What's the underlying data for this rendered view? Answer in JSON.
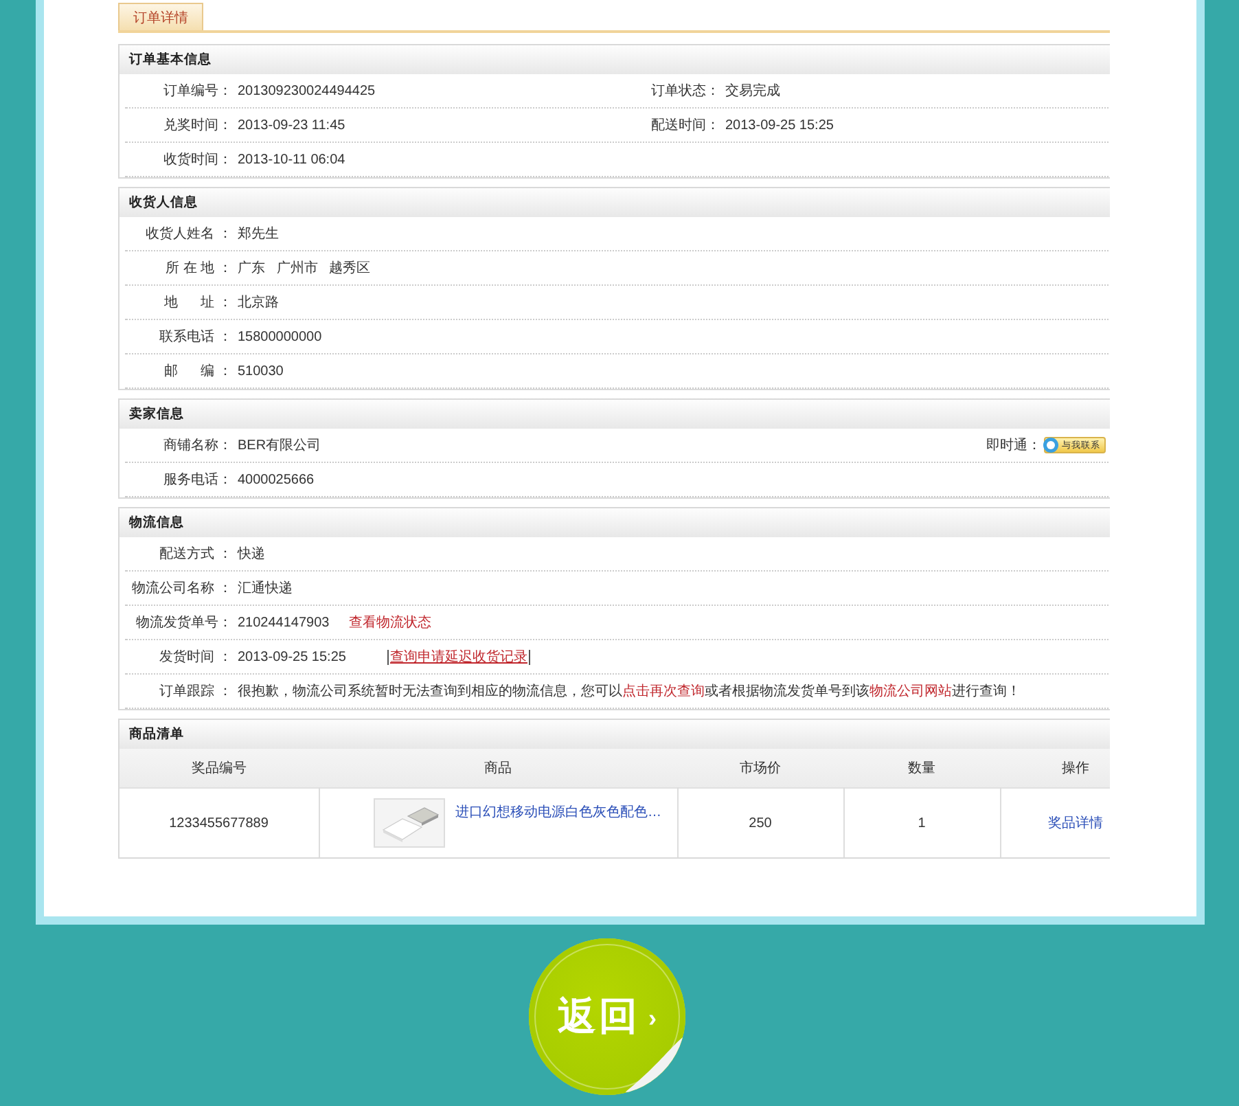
{
  "tab": {
    "label": "订单详情",
    "selected": true
  },
  "sections": [
    {
      "title": "订单基本信息",
      "kind": "fields",
      "rows": [
        {
          "fields": [
            {
              "label": "订单编号：",
              "parts": [
                {
                  "kind": "text",
                  "text": "201309230024494425"
                }
              ]
            },
            {
              "label": "订单状态：",
              "parts": [
                {
                  "kind": "text",
                  "text": "交易完成"
                }
              ]
            }
          ]
        },
        {
          "fields": [
            {
              "label": "兑奖时间：",
              "parts": [
                {
                  "kind": "text",
                  "text": "2013-09-23 11:45"
                }
              ]
            },
            {
              "label": "配送时间：",
              "parts": [
                {
                  "kind": "text",
                  "text": "2013-09-25 15:25"
                }
              ]
            }
          ]
        },
        {
          "fields": [
            {
              "label": "收货时间：",
              "parts": [
                {
                  "kind": "text",
                  "text": "2013-10-11 06:04"
                }
              ]
            }
          ]
        }
      ]
    },
    {
      "title": "收货人信息",
      "kind": "fields",
      "rows": [
        {
          "fields": [
            {
              "label": "收货人姓名 ：",
              "parts": [
                {
                  "kind": "text",
                  "text": "郑先生"
                }
              ]
            }
          ]
        },
        {
          "fields": [
            {
              "label": "所 在 地 ：",
              "parts": [
                {
                  "kind": "text",
                  "text": "广东   广州市   越秀区"
                }
              ]
            }
          ]
        },
        {
          "fields": [
            {
              "label": "地      址 ：",
              "parts": [
                {
                  "kind": "text",
                  "text": "北京路"
                }
              ]
            }
          ]
        },
        {
          "fields": [
            {
              "label": "联系电话 ：",
              "parts": [
                {
                  "kind": "text",
                  "text": "15800000000"
                }
              ]
            }
          ]
        },
        {
          "fields": [
            {
              "label": "邮      编 ：",
              "parts": [
                {
                  "kind": "text",
                  "text": "510030"
                }
              ]
            }
          ]
        }
      ]
    },
    {
      "title": "卖家信息",
      "kind": "fields",
      "rows": [
        {
          "fields": [
            {
              "label": "商铺名称：",
              "parts": [
                {
                  "kind": "text",
                  "text": "BER有限公司"
                }
              ]
            }
          ],
          "contact": {
            "label": "即时通：",
            "badge": "与我联系"
          }
        },
        {
          "fields": [
            {
              "label": "服务电话：",
              "parts": [
                {
                  "kind": "text",
                  "text": "4000025666"
                }
              ]
            }
          ]
        }
      ]
    },
    {
      "title": "物流信息",
      "kind": "fields",
      "rows": [
        {
          "fields": [
            {
              "label": "配送方式 ：",
              "parts": [
                {
                  "kind": "text",
                  "text": "快递"
                }
              ]
            }
          ]
        },
        {
          "fields": [
            {
              "label": "物流公司名称 ：",
              "parts": [
                {
                  "kind": "text",
                  "text": "汇通快递"
                }
              ]
            }
          ]
        },
        {
          "fields": [
            {
              "label": "物流发货单号：",
              "parts": [
                {
                  "kind": "text",
                  "text": "210244147903"
                },
                {
                  "kind": "link",
                  "text": "查看物流状态"
                }
              ]
            }
          ]
        },
        {
          "fields": [
            {
              "label": "发货时间 ：",
              "parts": [
                {
                  "kind": "text",
                  "text": "2013-09-25 15:25"
                },
                {
                  "kind": "bracket_link",
                  "text": "查询申请延迟收货记录"
                }
              ]
            }
          ]
        },
        {
          "fields": [
            {
              "label": "订单跟踪 ：",
              "parts": [
                {
                  "kind": "sentence",
                  "segments": [
                    {
                      "kind": "text",
                      "text": "很抱歉，物流公司系统暂时无法查询到相应的物流信息，您可以"
                    },
                    {
                      "kind": "link",
                      "text": "点击再次查询"
                    },
                    {
                      "kind": "text",
                      "text": "或者根据物流发货单号到该"
                    },
                    {
                      "kind": "link",
                      "text": "物流公司网站"
                    },
                    {
                      "kind": "text",
                      "text": "进行查询！"
                    }
                  ]
                }
              ]
            }
          ]
        }
      ]
    },
    {
      "title": "商品清单",
      "kind": "table",
      "columns": [
        "奖品编号",
        "商品",
        "市场价",
        "数量",
        "操作"
      ],
      "rows": [
        {
          "code": "1233455677889",
          "product": {
            "kind": "picture",
            "name": "进口幻想移动电源白色灰色配色…"
          },
          "price": "250",
          "quantity": "1",
          "action": "奖品详情"
        }
      ]
    }
  ],
  "back_button": {
    "label": "返回",
    "arrow": "›"
  }
}
